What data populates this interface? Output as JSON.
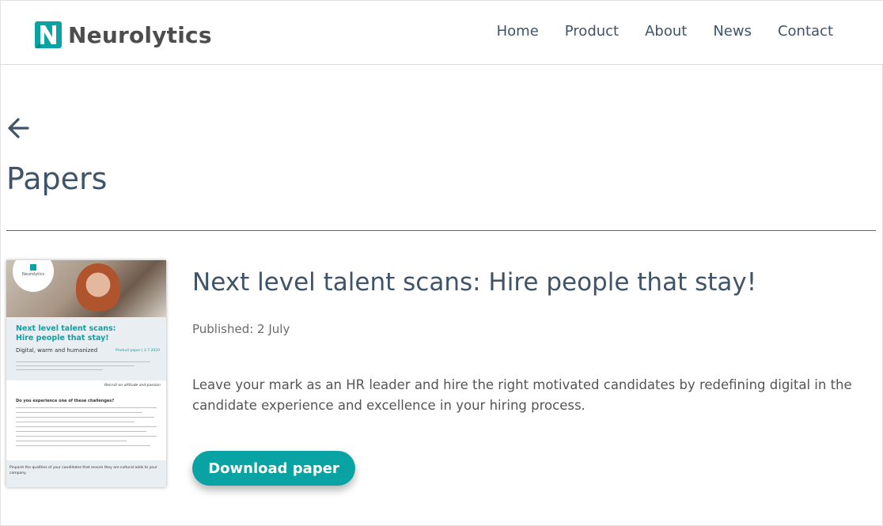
{
  "brand": {
    "name": "Neurolytics",
    "color": "#0aa3a3"
  },
  "nav": {
    "items": [
      "Home",
      "Product",
      "About",
      "News",
      "Contact"
    ]
  },
  "page": {
    "title": "Papers"
  },
  "paper": {
    "title": "Next level talent scans: Hire people that stay!",
    "published": "Published: 2 July",
    "description": "Leave your mark as an HR leader and hire the right motivated candidates by redefining digital in the candidate experience and excellence in your hiring process.",
    "download_label": "Download paper",
    "thumbnail": {
      "logo": "Neurolytics",
      "heading": "Next level talent scans: Hire people that stay!",
      "subheading": "Digital, warm and humanized",
      "tag": "Product paper | 2.7.2020",
      "note": "Recruit on attitude and passion",
      "question": "Do you experience one of these challenges?",
      "footer": "Pinpoint the qualities of your candidates that ensure they are cultural adds to your company."
    }
  }
}
